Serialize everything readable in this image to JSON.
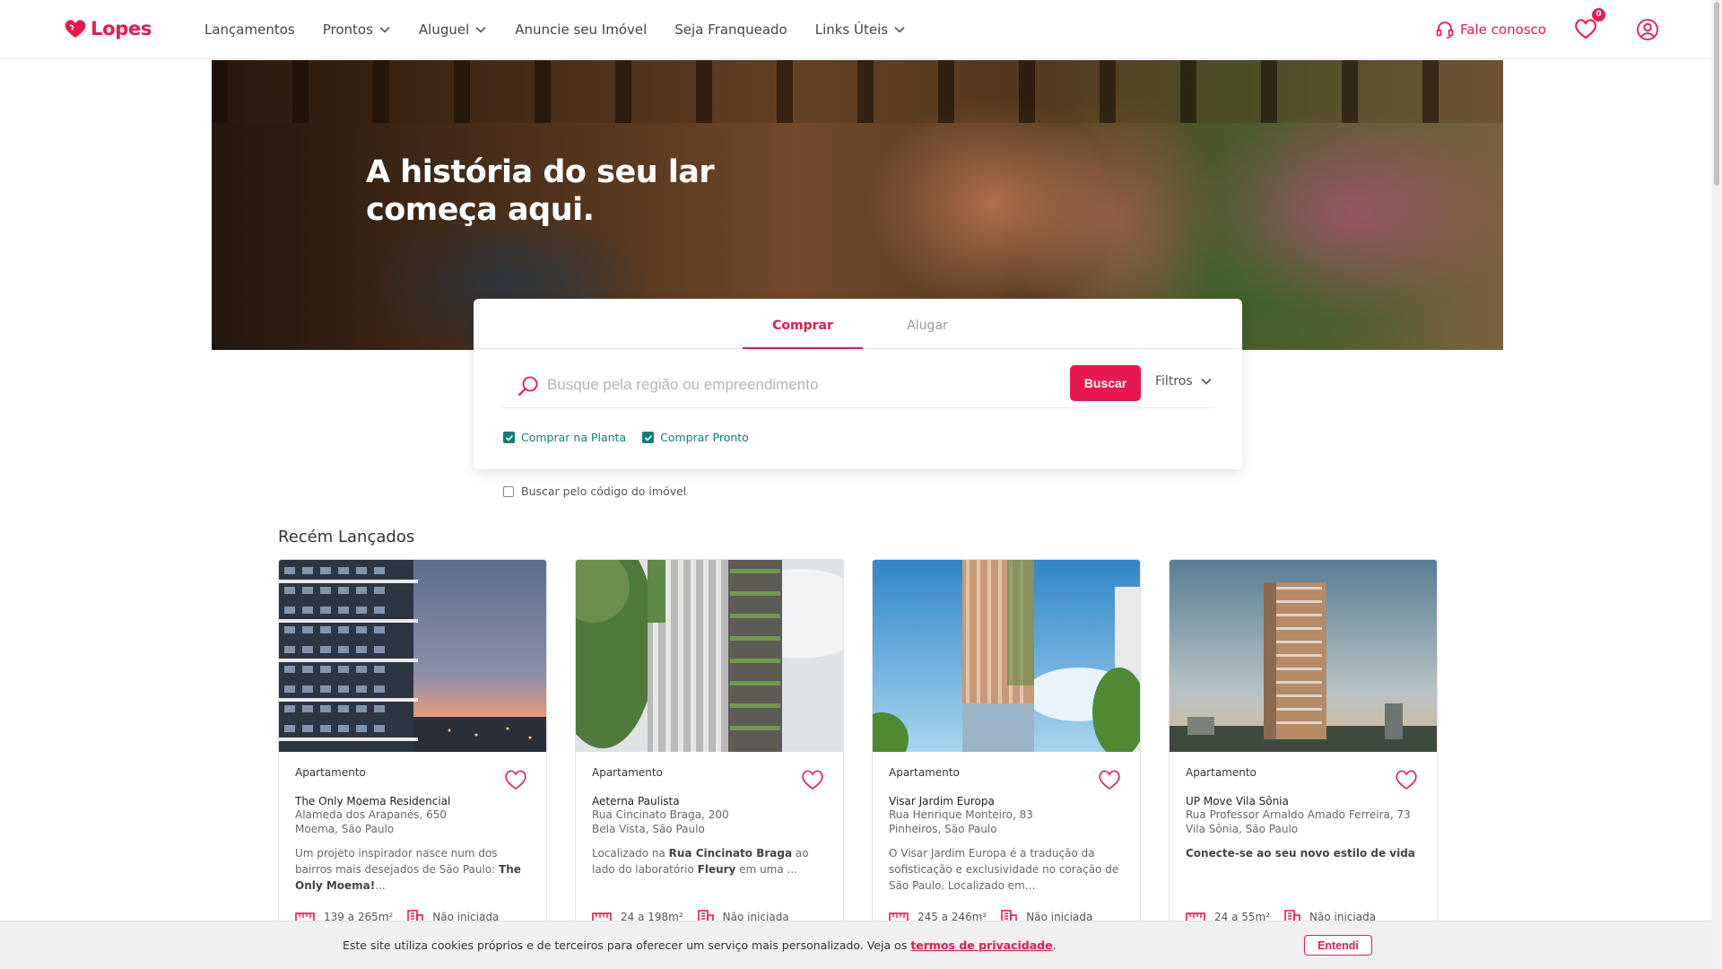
{
  "header": {
    "logo_text": "Lopes",
    "nav": [
      {
        "label": "Lançamentos",
        "dropdown": false
      },
      {
        "label": "Prontos",
        "dropdown": true
      },
      {
        "label": "Aluguel",
        "dropdown": true
      },
      {
        "label": "Anuncie seu Imóvel",
        "dropdown": false
      },
      {
        "label": "Seja Franqueado",
        "dropdown": false
      },
      {
        "label": "Links Úteis",
        "dropdown": true
      }
    ],
    "contact_label": "Fale conosco",
    "favorites_count": "0"
  },
  "hero": {
    "title": "A história do seu lar começa aqui."
  },
  "search": {
    "tabs": [
      "Comprar",
      "Alugar"
    ],
    "active_tab": "Comprar",
    "placeholder": "Busque pela região ou empreendimento",
    "button_label": "Buscar",
    "filters_label": "Filtros",
    "checks": [
      {
        "label": "Comprar na Planta",
        "checked": true
      },
      {
        "label": "Comprar Pronto",
        "checked": true
      }
    ],
    "code_search_label": "Buscar pelo código do imóvel"
  },
  "section": {
    "title": "Recém Lançados"
  },
  "cards": [
    {
      "type": "Apartamento",
      "name": "The Only Moema Residencial",
      "address": "Alameda dos Arapanés, 650",
      "district": "Moema, São Paulo",
      "desc_pre": "Um projeto inspirador nasce num dos bairros mais desejados de São Paulo: ",
      "desc_bold": "The Only Moema!",
      "desc_post": "...",
      "area": "139 a 265m²",
      "status": "Não iniciada"
    },
    {
      "type": "Apartamento",
      "name": "Aeterna Paulista",
      "address": "Rua Cincinato Braga, 200",
      "district": "Bela Vista, São Paulo",
      "desc_pre": "Localizado na ",
      "desc_bold": "Rua Cincinato Braga",
      "desc_mid": " ao lado do laboratório ",
      "desc_bold2": "Fleury",
      "desc_post": " em uma ...",
      "area": "24 a 198m²",
      "status": "Não iniciada"
    },
    {
      "type": "Apartamento",
      "name": "Visar Jardim Europa",
      "address": "Rua Henrique Monteiro, 83",
      "district": "Pinheiros, São Paulo",
      "desc_pre": "O Visar Jardim Europa é a tradução da sofisticação e exclusividade no coração de São Paulo. Localizado em...",
      "area": "245 a 246m²",
      "status": "Não iniciada"
    },
    {
      "type": "Apartamento",
      "name": "UP Move Vila Sônia",
      "address": "Rua Professor Arnaldo Amado Ferreira, 73",
      "district": "Vila Sônia, São Paulo",
      "desc_bold": "Conecte-se ao seu novo estilo de vida",
      "area": "24 a 55m²",
      "status": "Não iniciada"
    }
  ],
  "cookie": {
    "text": "Este site utiliza cookies próprios e de terceiros para oferecer um serviço mais personalizado. Veja os ",
    "link": "termos de privacidade",
    "suffix": ".",
    "button": "Entendi"
  },
  "colors": {
    "brand": "#e8194f",
    "check_green": "#0f7f74",
    "text_dark": "#333333"
  },
  "icons": [
    "heart-logo-icon",
    "chevron-down-icon",
    "headset-icon",
    "heart-icon",
    "user-circle-icon",
    "search-icon",
    "check-icon",
    "ruler-icon",
    "building-icon"
  ]
}
